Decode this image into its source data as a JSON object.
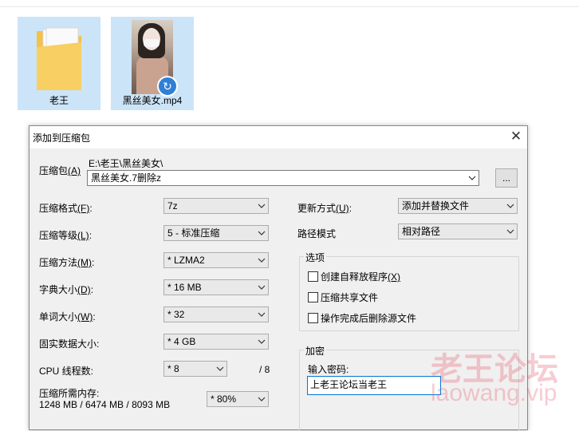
{
  "explorer": {
    "items": [
      {
        "label": "老王",
        "icon": "folder-icon"
      },
      {
        "label": "黑丝美女.mp4",
        "icon": "video-thumbnail-icon",
        "overlay": "shortcut-arrow-icon"
      }
    ]
  },
  "dialog": {
    "title": "添加到压缩包",
    "archive": {
      "label": "压缩包",
      "hotkey": "(A)",
      "path": "E:\\老王\\黑丝美女\\",
      "value": "黑丝美女.7删除z",
      "browse_label": "..."
    },
    "left": [
      {
        "label": "压缩格式",
        "hotkey": "(F)",
        "suffix": ":",
        "value": "7z"
      },
      {
        "label": "压缩等级",
        "hotkey": "(L)",
        "suffix": ":",
        "value": "5 - 标准压缩"
      },
      {
        "label": "压缩方法",
        "hotkey": "(M)",
        "suffix": ":",
        "value": "* LZMA2"
      },
      {
        "label": "字典大小",
        "hotkey": "(D)",
        "suffix": ":",
        "value": "* 16 MB"
      },
      {
        "label": "单词大小",
        "hotkey": "(W)",
        "suffix": ":",
        "value": "* 32"
      },
      {
        "label": "固实数据大小",
        "hotkey": "",
        "suffix": ":",
        "value": "* 4 GB"
      }
    ],
    "cpu_threads": {
      "label": "CPU 线程数",
      "suffix": ":",
      "value": "* 8",
      "max": "/ 8"
    },
    "memory": {
      "label": "压缩所需内存:",
      "stats": "1248 MB / 6474 MB / 8093 MB",
      "value": "* 80%"
    },
    "right": {
      "update_mode": {
        "label": "更新方式",
        "hotkey": "(U)",
        "suffix": ":",
        "value": "添加并替换文件"
      },
      "path_mode": {
        "label": "路径模式",
        "value": "相对路径"
      },
      "options": {
        "title": "选项",
        "checkboxes": [
          {
            "label": "创建自释放程序",
            "hotkey": "(X)",
            "checked": false
          },
          {
            "label": "压缩共享文件",
            "hotkey": "",
            "checked": false
          },
          {
            "label": "操作完成后删除源文件",
            "hotkey": "",
            "checked": false
          }
        ]
      },
      "encryption": {
        "title": "加密",
        "password_label": "输入密码:",
        "password_value": "上老王论坛当老王"
      }
    }
  },
  "watermark": {
    "line1": "老王论坛",
    "line2": "laowang.vip"
  },
  "colors": {
    "selection": "#cce4f7",
    "dialog_bg": "#f0f0f0",
    "focus_border": "#0078d7",
    "watermark": "#e64b60"
  }
}
